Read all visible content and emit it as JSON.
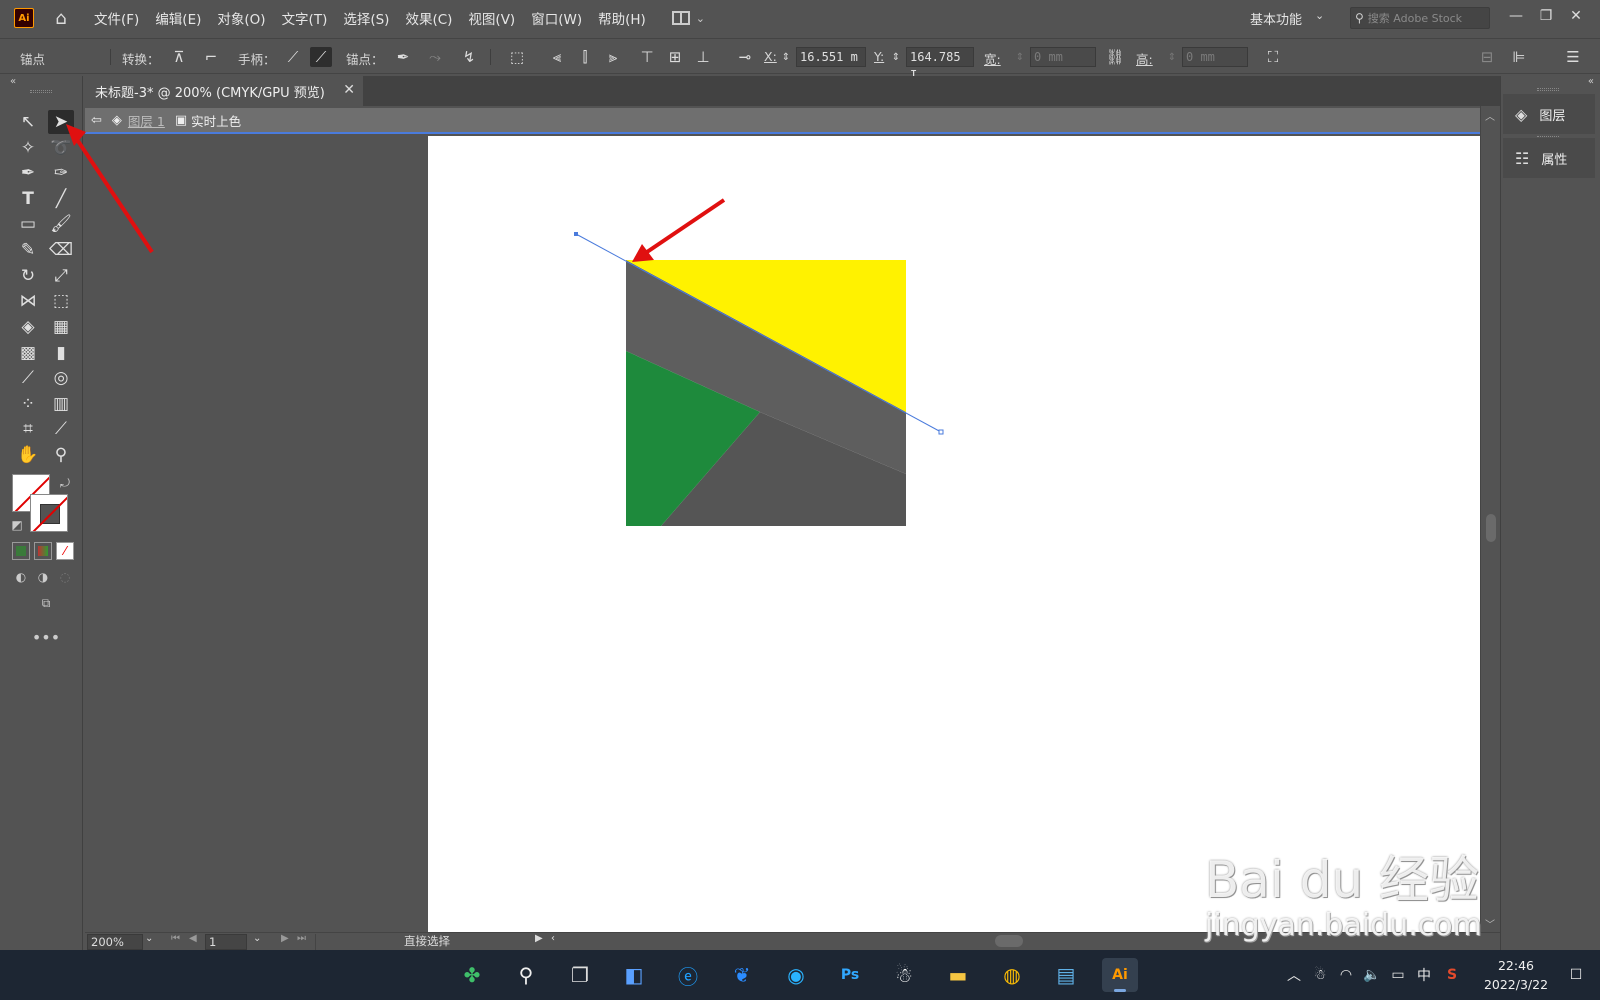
{
  "app": {
    "logo_text": "Ai"
  },
  "menu": {
    "items": [
      "文件(F)",
      "编辑(E)",
      "对象(O)",
      "文字(T)",
      "选择(S)",
      "效果(C)",
      "视图(V)",
      "窗口(W)",
      "帮助(H)"
    ],
    "workspace": "基本功能",
    "stock_placeholder": "搜索 Adobe Stock"
  },
  "control_bar": {
    "anchor_label": "锚点",
    "convert_label": "转换：",
    "handle_label": "手柄：",
    "anchor_points_label": "锚点：",
    "x_label": "X:",
    "x_value": "16.551 m",
    "y_label": "Y:",
    "y_value": "164.785 I",
    "width_label": "宽:",
    "width_value": "0 mm",
    "height_label": "高:",
    "height_value": "0 mm"
  },
  "document": {
    "tab_title": "未标题-3* @ 200% (CMYK/GPU 预览)",
    "layer_name": "图层 1",
    "group_name": "实时上色"
  },
  "status_bar": {
    "zoom": "200%",
    "page": "1",
    "tool_name": "直接选择"
  },
  "right_panel": {
    "layers": "图层",
    "properties": "属性"
  },
  "artwork": {
    "yellow": "#fff200",
    "gray_dark": "#555555",
    "gray_mid": "#5e5e5e",
    "green": "#1e8a3c",
    "path_color": "#4a7bdc"
  },
  "taskbar": {
    "time": "22:46",
    "date": "2022/3/22",
    "ime": "中"
  },
  "watermark": {
    "site": "jingyan.baidu.com",
    "brand": "Bai du 经验"
  }
}
